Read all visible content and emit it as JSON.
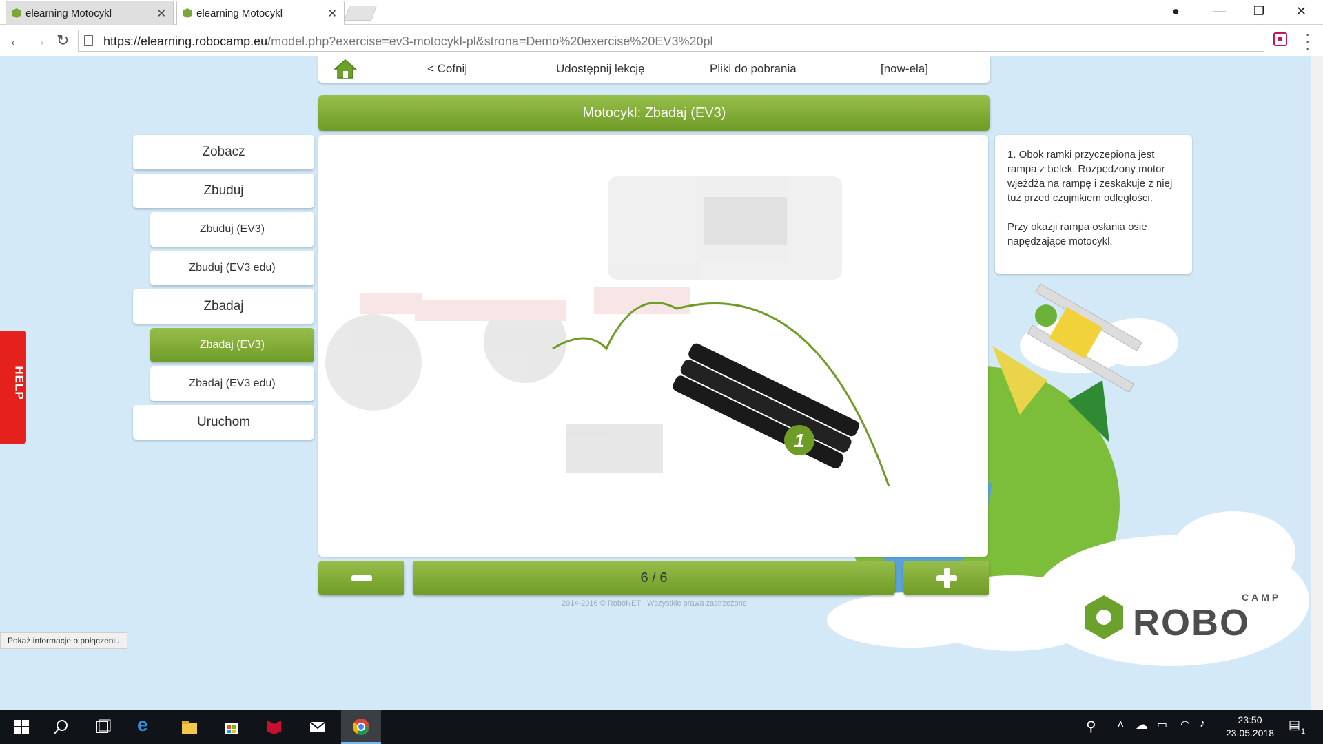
{
  "browser": {
    "tabs": [
      {
        "title": "elearning Motocykl",
        "active": false
      },
      {
        "title": "elearning Motocykl",
        "active": true
      }
    ],
    "url_host": "https://elearning.robocamp.eu",
    "url_rest": "/model.php?exercise=ev3-motocykl-pl&strona=Demo%20exercise%20EV3%20pl"
  },
  "topnav": {
    "back": "< Cofnij",
    "share": "Udostępnij lekcję",
    "downloads": "Pliki do pobrania",
    "user": "[now-ela]"
  },
  "title": "Motocykl: Zbadaj (EV3)",
  "sidebar": {
    "items": [
      {
        "label": "Zobacz",
        "level": "main",
        "active": false
      },
      {
        "label": "Zbuduj",
        "level": "main",
        "active": false
      },
      {
        "label": "Zbuduj (EV3)",
        "level": "sub",
        "active": false
      },
      {
        "label": "Zbuduj (EV3 edu)",
        "level": "sub",
        "active": false
      },
      {
        "label": "Zbadaj",
        "level": "main",
        "active": false
      },
      {
        "label": "Zbadaj (EV3)",
        "level": "sub",
        "active": true
      },
      {
        "label": "Zbadaj (EV3 edu)",
        "level": "sub",
        "active": false
      },
      {
        "label": "Uruchom",
        "level": "main",
        "active": false
      }
    ]
  },
  "viewer": {
    "callout_number": "1"
  },
  "tooltip": {
    "paragraph1": "1. Obok ramki przyczepiona jest rampa z belek. Rozpędzony motor wjeżdża na rampę i zeskakuje z niej tuż przed czujnikiem odległości.",
    "paragraph2": "Przy okazji rampa osłania osie napędzające motocykl."
  },
  "controls": {
    "counter": "6 / 6"
  },
  "copyright": "2014-2016 © RoboNET : Wszystkie prawa zastrzeżone",
  "help_label": "HELP",
  "status_bubble": "Pokaż informacje o połączeniu",
  "logo": {
    "camp": "CAMP",
    "robo": "ROBO"
  },
  "taskbar": {
    "time": "23:50",
    "date": "23.05.2018",
    "notification_count": "1"
  },
  "colors": {
    "accent_green": "#7da63a",
    "sky": "#d3e9f8",
    "help_red": "#e5211e"
  }
}
